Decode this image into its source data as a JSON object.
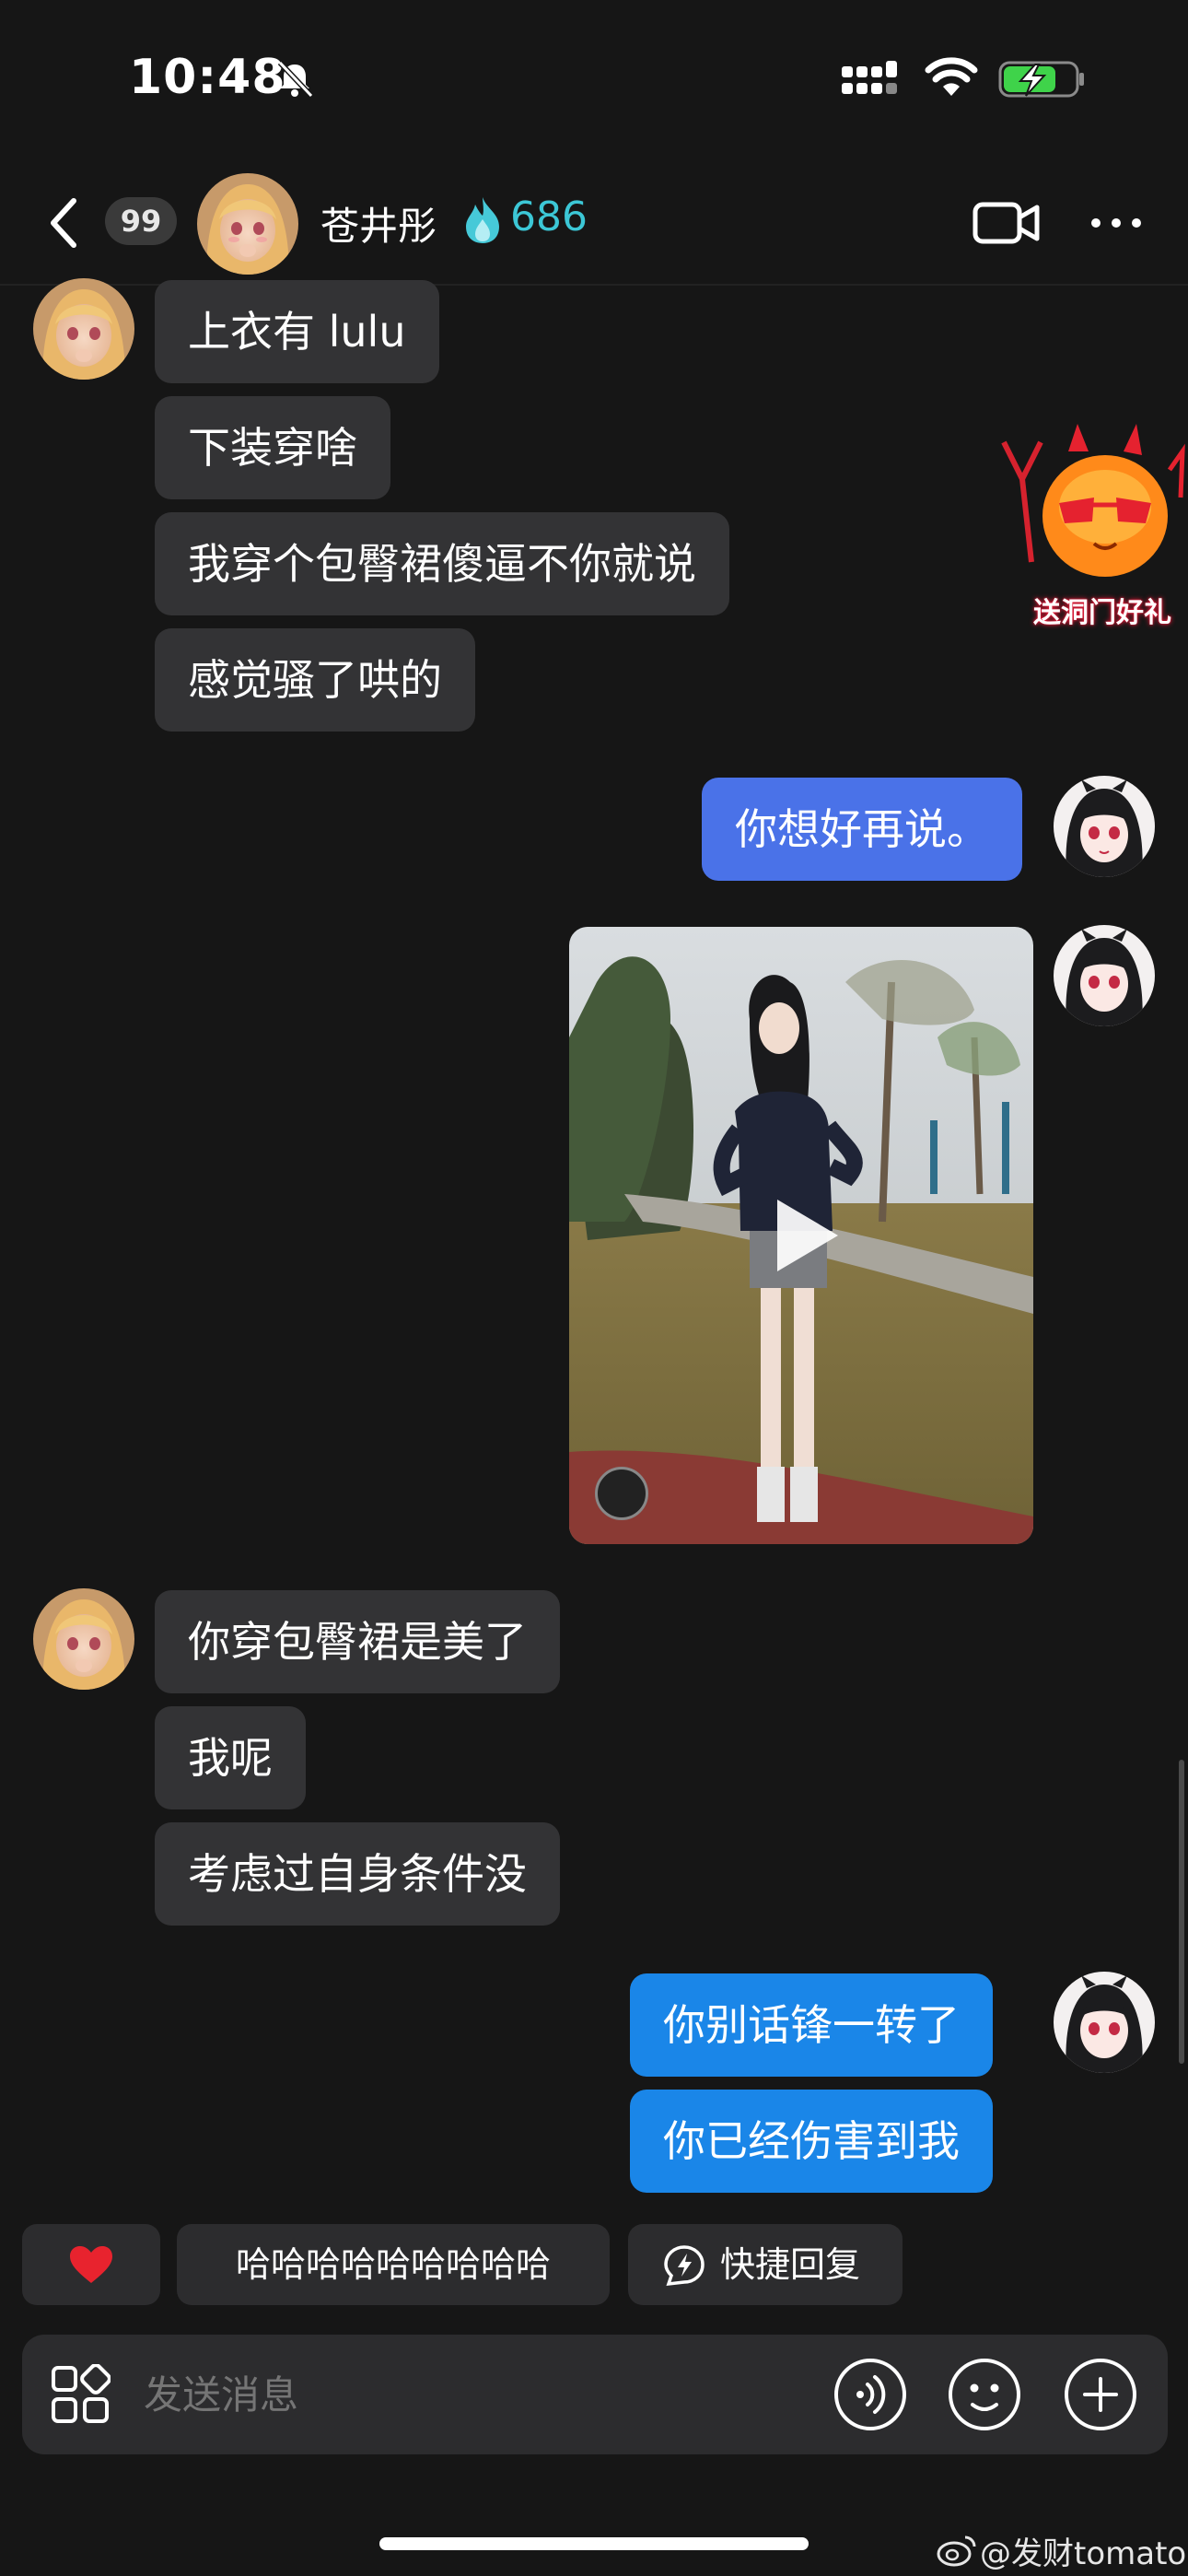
{
  "status_bar": {
    "time": "10:48"
  },
  "header": {
    "unread_count": "99",
    "contact_name": "苍井彤",
    "fire_count": "686"
  },
  "messages": [
    {
      "side": "in",
      "text": "上衣有 lulu"
    },
    {
      "side": "in",
      "text": "下装穿啥"
    },
    {
      "side": "in",
      "text": "我穿个包臀裙傻逼不你就说"
    },
    {
      "side": "in",
      "text": "感觉骚了哄的"
    },
    {
      "side": "out",
      "text": "你想好再说。"
    },
    {
      "side": "out",
      "type": "video"
    },
    {
      "side": "in",
      "text": "你穿包臀裙是美了"
    },
    {
      "side": "in",
      "text": "我呢"
    },
    {
      "side": "in",
      "text": "考虑过自身条件没"
    },
    {
      "side": "out",
      "text": "你别话锋一转了"
    },
    {
      "side": "out",
      "text": "你已经伤害到我"
    }
  ],
  "gift_banner": {
    "label": "送洞门好礼"
  },
  "quick_replies": {
    "laugh": "哈哈哈哈哈哈哈哈哈",
    "quick": "快捷回复"
  },
  "input": {
    "placeholder": "发送消息"
  },
  "watermark": "@发财tomato",
  "colors": {
    "background": "#161616",
    "incoming_bubble": "#333335",
    "outgoing_bubble_1": "#4a72e8",
    "outgoing_bubble_2": "#1a86e8",
    "accent_fire": "#3cc7d6"
  }
}
